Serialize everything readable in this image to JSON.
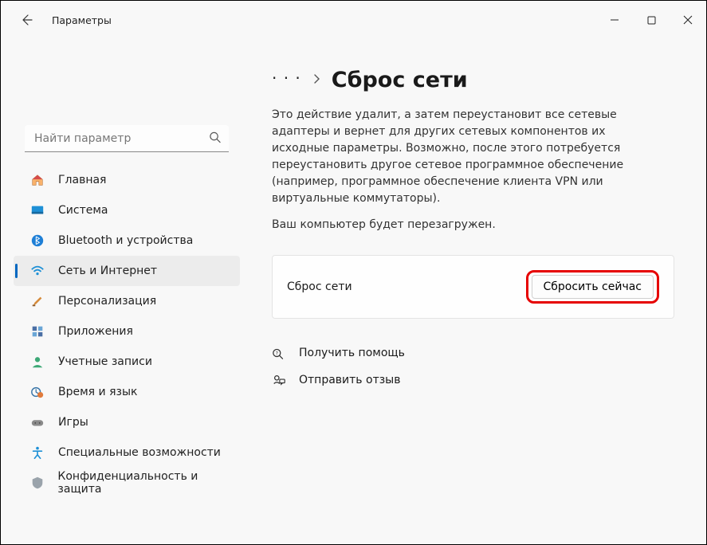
{
  "window": {
    "title": "Параметры"
  },
  "search": {
    "placeholder": "Найти параметр"
  },
  "sidebar": {
    "items": [
      {
        "label": "Главная"
      },
      {
        "label": "Система"
      },
      {
        "label": "Bluetooth и устройства"
      },
      {
        "label": "Сеть и Интернет"
      },
      {
        "label": "Персонализация"
      },
      {
        "label": "Приложения"
      },
      {
        "label": "Учетные записи"
      },
      {
        "label": "Время и язык"
      },
      {
        "label": "Игры"
      },
      {
        "label": "Специальные возможности"
      },
      {
        "label": "Конфиденциальность и защита"
      }
    ]
  },
  "breadcrumb": {
    "title": "Сброс сети"
  },
  "content": {
    "description": "Это действие удалит, а затем переустановит все сетевые адаптеры и вернет для других сетевых компонентов их исходные параметры. Возможно, после этого потребуется переустановить другое сетевое программное обеспечение (например, программное обеспечение клиента VPN или виртуальные коммутаторы).",
    "note": "Ваш компьютер будет перезагружен.",
    "card": {
      "label": "Сброс сети",
      "button": "Сбросить сейчас"
    },
    "help": {
      "get_help": "Получить помощь",
      "feedback": "Отправить отзыв"
    }
  }
}
